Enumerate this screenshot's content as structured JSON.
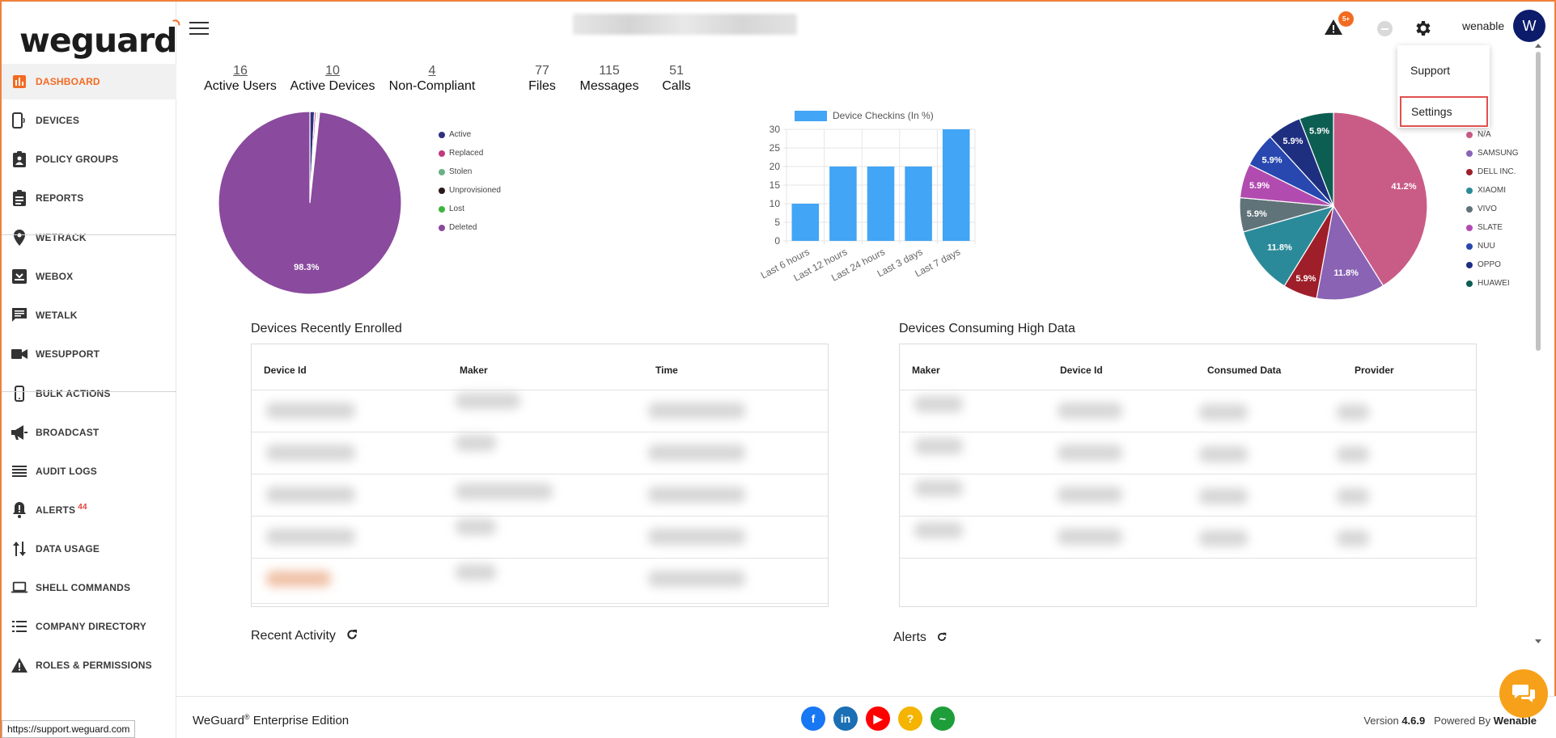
{
  "app": {
    "brand": "weguard",
    "username": "wenable",
    "avatar_letter": "W",
    "alert_badge": "5+"
  },
  "sidebar": {
    "items": [
      {
        "label": "DASHBOARD",
        "icon": "bar-chart-icon",
        "active": true
      },
      {
        "label": "DEVICES",
        "icon": "phone-icon"
      },
      {
        "label": "POLICY GROUPS",
        "icon": "clipboard-person-icon"
      },
      {
        "label": "REPORTS",
        "icon": "clipboard-list-icon"
      },
      {
        "label": "WETRACK",
        "icon": "location-pin-icon"
      },
      {
        "label": "WEBOX",
        "icon": "inbox-icon"
      },
      {
        "label": "WETALK",
        "icon": "chat-icon"
      },
      {
        "label": "WESUPPORT",
        "icon": "video-camera-icon"
      },
      {
        "label": "BULK ACTIONS",
        "icon": "mobile-icon"
      },
      {
        "label": "BROADCAST",
        "icon": "megaphone-icon"
      },
      {
        "label": "AUDIT LOGS",
        "icon": "list-lines-icon"
      },
      {
        "label": "ALERTS",
        "icon": "bell-alert-icon",
        "badge": "44"
      },
      {
        "label": "DATA USAGE",
        "icon": "arrows-updown-icon"
      },
      {
        "label": "SHELL COMMANDS",
        "icon": "laptop-icon"
      },
      {
        "label": "COMPANY DIRECTORY",
        "icon": "directory-list-icon"
      },
      {
        "label": "ROLES & PERMISSIONS",
        "icon": "warning-triangle-icon"
      }
    ]
  },
  "dropdown": {
    "support": "Support",
    "settings": "Settings"
  },
  "stats": [
    {
      "value": "16",
      "label": "Active Users"
    },
    {
      "value": "10",
      "label": "Active Devices"
    },
    {
      "value": "4",
      "label": "Non-Compliant"
    },
    {
      "value": "77",
      "label": "Files"
    },
    {
      "value": "115",
      "label": "Messages"
    },
    {
      "value": "51",
      "label": "Calls"
    }
  ],
  "chart_data": [
    {
      "type": "pie",
      "title": "",
      "labels": [
        "Active",
        "Replaced",
        "Stolen",
        "Unprovisioned",
        "Lost",
        "Deleted"
      ],
      "values": [
        0.8,
        0.3,
        0.2,
        0.2,
        0.2,
        98.3
      ],
      "data_labels": [
        "",
        "",
        "",
        "",
        "",
        "98.3%"
      ],
      "colors": [
        "#2f2f80",
        "#c2397e",
        "#6ab187",
        "#2b1a1a",
        "#3fb43f",
        "#8a4a9e"
      ],
      "legend": "right"
    },
    {
      "type": "bar",
      "series": [
        {
          "name": "Device Checkins (In %)",
          "values": [
            10,
            20,
            20,
            20,
            30
          ]
        }
      ],
      "categories": [
        "Last 6 hours",
        "Last 12 hours",
        "Last 24 hours",
        "Last 3 days",
        "Last 7 days"
      ],
      "ylim": [
        0,
        30
      ],
      "yticks": [
        0,
        5,
        10,
        15,
        20,
        25,
        30
      ],
      "color": "#42a5f5",
      "grid": true,
      "legend": "top"
    },
    {
      "type": "pie",
      "title": "",
      "labels": [
        "N/A",
        "SAMSUNG",
        "DELL INC.",
        "XIAOMI",
        "VIVO",
        "SLATE",
        "NUU",
        "OPPO",
        "HUAWEI"
      ],
      "values": [
        41.2,
        11.8,
        5.9,
        11.8,
        5.9,
        5.9,
        5.9,
        5.9,
        5.9
      ],
      "data_labels": [
        "41.2%",
        "11.8%",
        "5.9%",
        "11.8%",
        "5.9%",
        "5.9%",
        "5.9%",
        "5.9%",
        "5.9%"
      ],
      "colors": [
        "#c95c86",
        "#8a63b5",
        "#9e1f2a",
        "#2b8a99",
        "#607378",
        "#b24bb0",
        "#2848b0",
        "#1f2f80",
        "#0d5e52"
      ],
      "legend": "right"
    }
  ],
  "enrolled": {
    "title": "Devices Recently Enrolled",
    "headers": [
      "Device Id",
      "Maker",
      "Time"
    ]
  },
  "high_data": {
    "title": "Devices Consuming High Data",
    "headers": [
      "Maker",
      "Device Id",
      "Consumed Data",
      "Provider"
    ]
  },
  "recent_activity": "Recent Activity",
  "alerts_title": "Alerts",
  "footer": {
    "edition_brand": "WeGuard",
    "reg": "®",
    "edition_suffix": " Enterprise Edition",
    "version_label": "Version ",
    "version": "4.6.9",
    "powered_label": "Powered By ",
    "powered_by": "Wenable"
  },
  "status_url": "https://support.weguard.com",
  "social": [
    {
      "icon": "facebook-icon",
      "color": "#1877f2",
      "glyph": "f"
    },
    {
      "icon": "linkedin-icon",
      "color": "#1a6fb5",
      "glyph": "in"
    },
    {
      "icon": "youtube-icon",
      "color": "#ff0000",
      "glyph": "▶"
    },
    {
      "icon": "help-icon",
      "color": "#f4b400",
      "glyph": "?"
    },
    {
      "icon": "pulse-icon",
      "color": "#1e9e3a",
      "glyph": "~"
    }
  ]
}
